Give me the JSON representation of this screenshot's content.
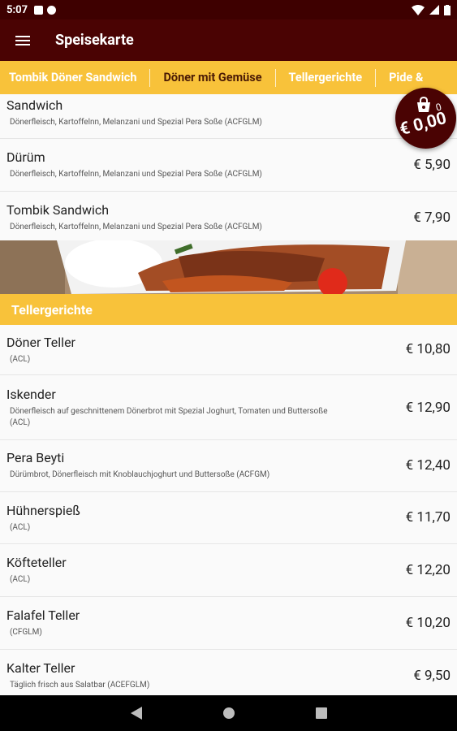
{
  "status_bar": {
    "time": "5:07"
  },
  "app_bar": {
    "title": "Speisekarte"
  },
  "tabs": [
    {
      "label": "Tombik Döner Sandwich"
    },
    {
      "label": "Döner mit Gemüse"
    },
    {
      "label": "Tellergerichte"
    },
    {
      "label": "Pide &"
    }
  ],
  "top_items": [
    {
      "name": "Sandwich",
      "desc": "Dönerfleisch, Kartoffelnn, Melanzani und Spezial Pera Soße (ACFGLM)",
      "price": ""
    },
    {
      "name": "Dürüm",
      "desc": "Dönerfleisch, Kartoffelnn, Melanzani und Spezial Pera Soße (ACFGLM)",
      "price": "€ 5,90"
    },
    {
      "name": "Tombik Sandwich",
      "desc": "Dönerfleisch, Kartoffelnn, Melanzani und Spezial Pera Soße (ACFGLM)",
      "price": "€ 7,90"
    }
  ],
  "section": {
    "title": "Tellergerichte"
  },
  "teller_items": [
    {
      "name": "Döner Teller",
      "desc": "(ACL)",
      "price": "€ 10,80"
    },
    {
      "name": "Iskender",
      "desc": "Dönerfleisch auf geschnittenem Dönerbrot mit Spezial Joghurt, Tomaten und Buttersoße (ACL)",
      "price": "€ 12,90"
    },
    {
      "name": "Pera Beyti",
      "desc": "Dürümbrot, Dönerfleisch mit Knoblauchjoghurt und Buttersoße (ACFGM)",
      "price": "€ 12,40"
    },
    {
      "name": "Hühnerspieß",
      "desc": "(ACL)",
      "price": "€ 11,70"
    },
    {
      "name": "Köfteteller",
      "desc": "(ACL)",
      "price": "€ 12,20"
    },
    {
      "name": "Falafel Teller",
      "desc": "(CFGLM)",
      "price": "€ 10,20"
    },
    {
      "name": "Kalter Teller",
      "desc": "Täglich frisch aus Salatbar (ACEFGLM)",
      "price": "€ 9,50"
    }
  ],
  "cart": {
    "count": "0",
    "total": "€ 0,00"
  },
  "colors": {
    "primary": "#4a0303",
    "accent": "#f8c23a",
    "statusbar": "#3e0000"
  }
}
